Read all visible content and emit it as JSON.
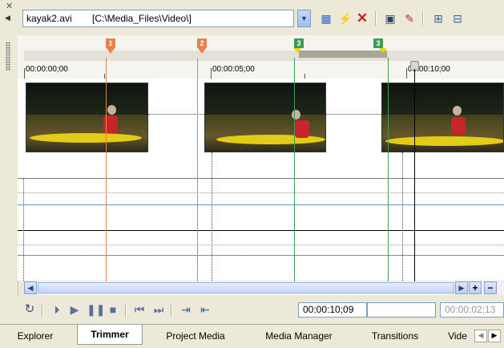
{
  "toolbar": {
    "file_name": "kayak2.avi",
    "file_path": "[C:\\Media_Files\\Video\\]",
    "buttons": {
      "dropdown": "chevron-down-icon",
      "add_to_timeline": "add-to-timeline-icon",
      "remove_all": "lightning-icon",
      "delete": "close-icon",
      "save": "save-icon",
      "clear_markers": "clear-markers-icon",
      "zoom": "zoom-selection-icon"
    }
  },
  "ruler": {
    "timecodes": [
      "00:00:00;00",
      "00:00:05;00",
      "00:00:10;00"
    ],
    "markers": [
      "1",
      "2"
    ],
    "regions": [
      "3",
      "3"
    ]
  },
  "transport": {
    "current_time": "00:00:10;09",
    "selection_start": "",
    "selection_length": "00:00:02;13"
  },
  "tabs": [
    {
      "label": "Explorer"
    },
    {
      "label": "Trimmer"
    },
    {
      "label": "Project Media"
    },
    {
      "label": "Media Manager"
    },
    {
      "label": "Transitions"
    },
    {
      "label": "Vide"
    }
  ],
  "colors": {
    "marker": "#e7824a",
    "region": "#3d9b55",
    "loop": "#a8a697",
    "kayak": "#e3cc17",
    "paddler_jacket": "#c8252b"
  }
}
